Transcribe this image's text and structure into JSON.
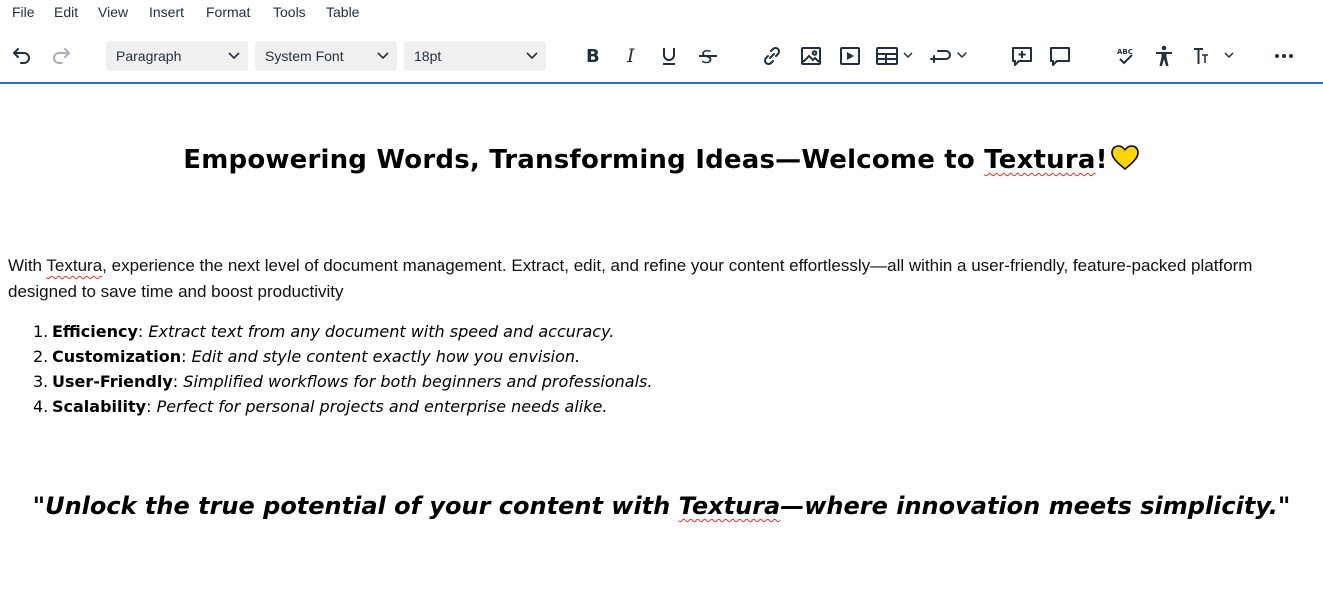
{
  "menubar": {
    "items": [
      "File",
      "Edit",
      "View",
      "Insert",
      "Format",
      "Tools",
      "Table"
    ]
  },
  "toolbar": {
    "block_format": "Paragraph",
    "font_family": "System Font",
    "font_size": "18pt",
    "icons": [
      "undo-icon",
      "redo-icon",
      "bold-icon",
      "italic-icon",
      "underline-icon",
      "strikethrough-icon",
      "link-icon",
      "image-icon",
      "media-icon",
      "table-icon",
      "template-icon",
      "add-comment-icon",
      "comments-icon",
      "spellcheck-icon",
      "accessibility-icon",
      "text-size-icon",
      "more-icon"
    ]
  },
  "document": {
    "title_before": "Empowering Words, Transforming Ideas—Welcome to ",
    "title_brand": "Textura",
    "title_after": "!",
    "intro_before": "With ",
    "intro_brand": "Textura",
    "intro_after": ", experience the next level of document management. Extract, edit, and refine your content effortlessly—all within a user-friendly, feature-packed platform designed to save time and boost productivity",
    "features": [
      {
        "num": "1.",
        "name": "Efficiency",
        "desc": "Extract text from any document with speed and accuracy."
      },
      {
        "num": "2.",
        "name": "Customization",
        "desc": "Edit and style content exactly how you envision."
      },
      {
        "num": "3.",
        "name": "User-Friendly",
        "desc": "Simplified workflows for both beginners and professionals."
      },
      {
        "num": "4.",
        "name": "Scalability",
        "desc": "Perfect for personal projects and enterprise needs alike."
      }
    ],
    "quote_before": "\"Unlock the true potential of your content with ",
    "quote_brand": "Textura",
    "quote_after": "—where innovation meets simplicity.\"",
    "heart_icon": "yellow-heart-icon"
  },
  "colors": {
    "accent": "#2b6fc2",
    "spellcheck": "#e03333",
    "heart": "#ffd400"
  }
}
